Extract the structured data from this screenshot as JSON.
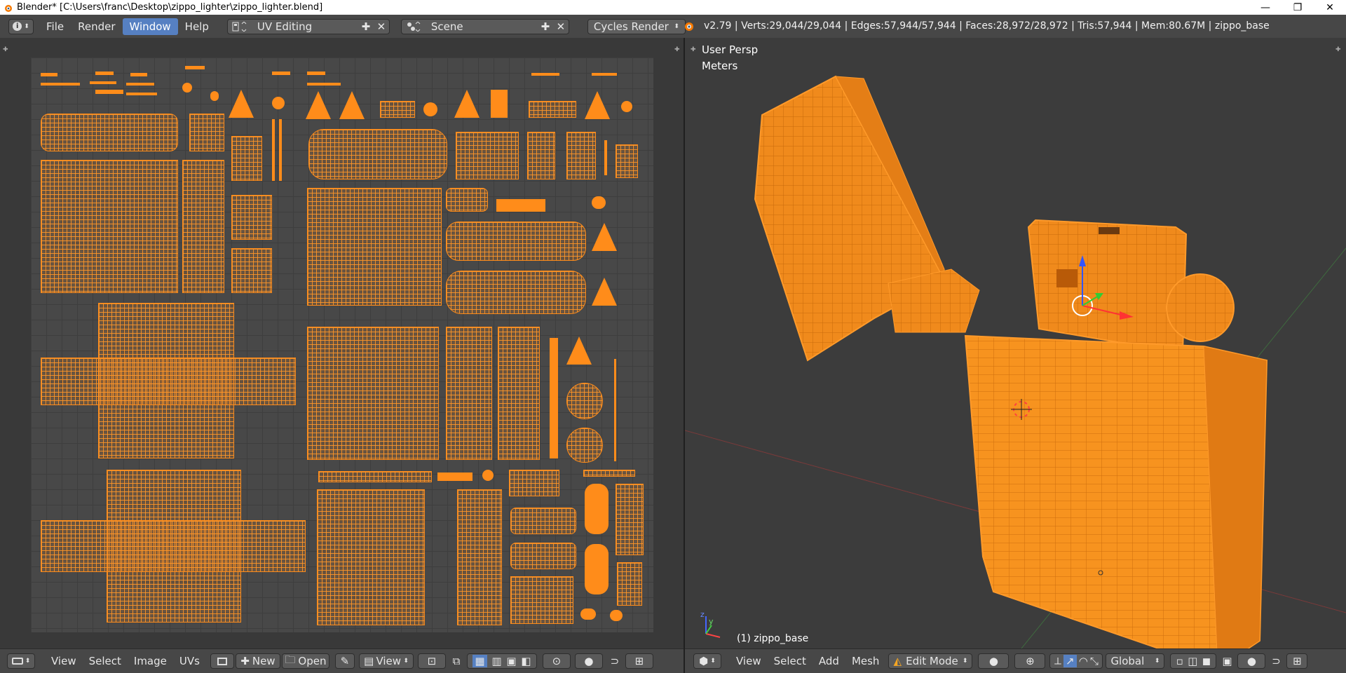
{
  "window": {
    "title": "Blender* [C:\\Users\\franc\\Desktop\\zippo_lighter\\zippo_lighter.blend]",
    "controls": [
      "—",
      "❐",
      "✕"
    ]
  },
  "info_header": {
    "menus": [
      "File",
      "Render",
      "Window",
      "Help"
    ],
    "active_menu": "Window",
    "screen_layout": "UV Editing",
    "scene": "Scene",
    "render_engine": "Cycles Render",
    "stats": "v2.79 | Verts:29,044/29,044 | Edges:57,944/57,944 | Faces:28,972/28,972 | Tris:57,944 | Mem:80.67M | zippo_base"
  },
  "uv_editor": {
    "header": {
      "menus": [
        "View",
        "Select",
        "Image",
        "UVs"
      ],
      "new_label": "New",
      "open_label": "Open",
      "view_label": "View"
    }
  },
  "viewport": {
    "perspective_label": "User Persp",
    "units_label": "Meters",
    "object_label": "(1) zippo_base",
    "header": {
      "menus": [
        "View",
        "Select",
        "Add",
        "Mesh"
      ],
      "mode": "Edit Mode",
      "orientation": "Global"
    }
  },
  "colors": {
    "accent": "#5680c2",
    "selection": "#ff8c1a",
    "background": "#3d3d3d"
  }
}
